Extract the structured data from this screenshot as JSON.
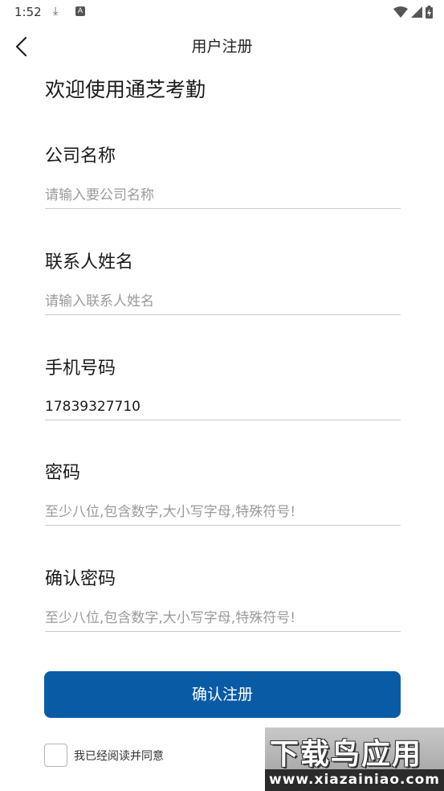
{
  "status_bar": {
    "time": "1:52",
    "download_icon": "download-icon",
    "a_badge": "A"
  },
  "nav": {
    "title": "用户注册",
    "back_icon": "chevron-left-icon"
  },
  "welcome": "欢迎使用通芝考勤",
  "fields": [
    {
      "label": "公司名称",
      "placeholder": "请输入要公司名称",
      "value": ""
    },
    {
      "label": "联系人姓名",
      "placeholder": "请输入联系人姓名",
      "value": ""
    },
    {
      "label": "手机号码",
      "placeholder": "",
      "value": "17839327710"
    },
    {
      "label": "密码",
      "placeholder": "至少八位,包含数字,大小写字母,特殊符号!",
      "value": ""
    },
    {
      "label": "确认密码",
      "placeholder": "至少八位,包含数字,大小写字母,特殊符号!",
      "value": ""
    }
  ],
  "submit_label": "确认注册",
  "agree_text": "我已经阅读并同意",
  "watermark": {
    "title": "下载鸟应用",
    "url": "www.xiazainiao.com"
  },
  "colors": {
    "accent": "#0a5ba6",
    "divider": "#c8c8c8",
    "placeholder": "#9a9a9a"
  }
}
